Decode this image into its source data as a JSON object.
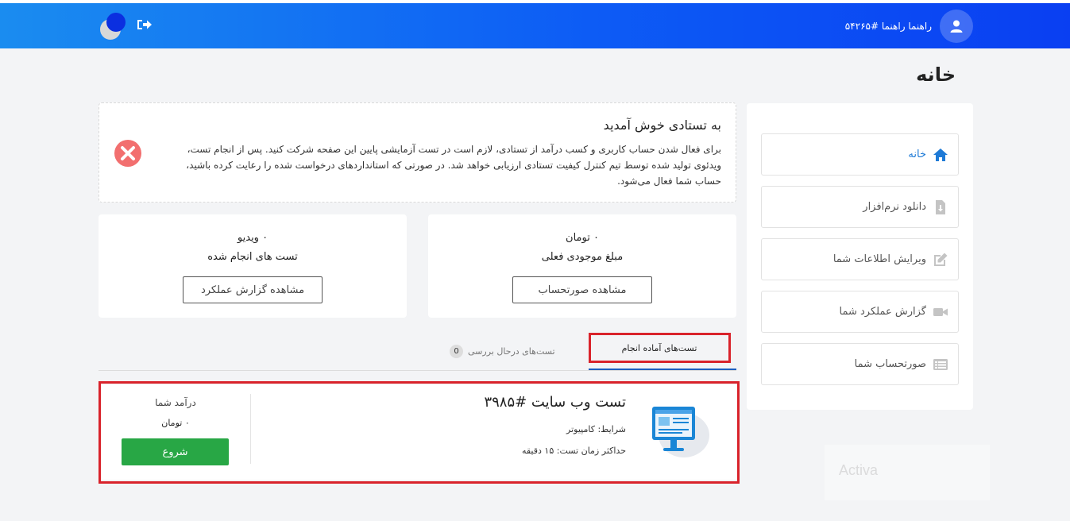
{
  "header": {
    "user_name": "راهنما راهنما #۵۴۲۶۵",
    "icons": [
      "user-icon",
      "logout-icon",
      "dark-mode-moon-icon"
    ]
  },
  "page": {
    "title": "خانه"
  },
  "sidebar": {
    "items": [
      {
        "label": "خانه",
        "icon": "home-icon",
        "active": true
      },
      {
        "label": "دانلود نرم‌افزار",
        "icon": "file-download-icon",
        "active": false
      },
      {
        "label": "ویرایش اطلاعات شما",
        "icon": "edit-icon",
        "active": false
      },
      {
        "label": "گزارش عملکرد شما",
        "icon": "video-icon",
        "active": false
      },
      {
        "label": "صورتحساب شما",
        "icon": "list-icon",
        "active": false
      }
    ]
  },
  "welcome": {
    "title": "به تستادی خوش آمدید",
    "body": "برای فعال شدن حساب کاربری و کسب درآمد از تستادی، لازم است در تست آزمایشی پایین این صفحه شرکت کنید. پس از انجام تست، ویدئوی تولید شده توسط تیم کنترل کیفیت تستادی ارزیابی خواهد شد. در صورتی که استانداردهای درخواست شده را رعایت کرده باشید، حساب شما فعال می‌شود."
  },
  "stats": {
    "balance": {
      "value": "۰ تومان",
      "label": "مبلغ موجودی فعلی",
      "button": "مشاهده صورتحساب"
    },
    "tests": {
      "value": "۰ ویدیو",
      "label": "تست های انجام شده",
      "button": "مشاهده گزارش عملکرد"
    }
  },
  "tabs": {
    "ready": {
      "label": "تست‌های آماده انجام"
    },
    "review": {
      "label": "تست‌های درحال بررسی",
      "count": "0"
    }
  },
  "test": {
    "title": "تست وب سایت #۳۹۸۵",
    "conditions_label": "شرایط:",
    "conditions_value": "کامپیوتر",
    "max_time_label": "حداکثر زمان تست:",
    "max_time_value": "۱۵ دقیقه",
    "income_label": "درآمد شما",
    "income_value": "۰ تومان",
    "start_button": "شروع"
  },
  "overlay": {
    "watermark": "Activa"
  },
  "colors": {
    "header_start": "#1a8cf0",
    "header_end": "#0a3ff2",
    "active_link": "#1e7ad6",
    "start_button": "#28a745",
    "highlight_box": "#d9232b"
  }
}
